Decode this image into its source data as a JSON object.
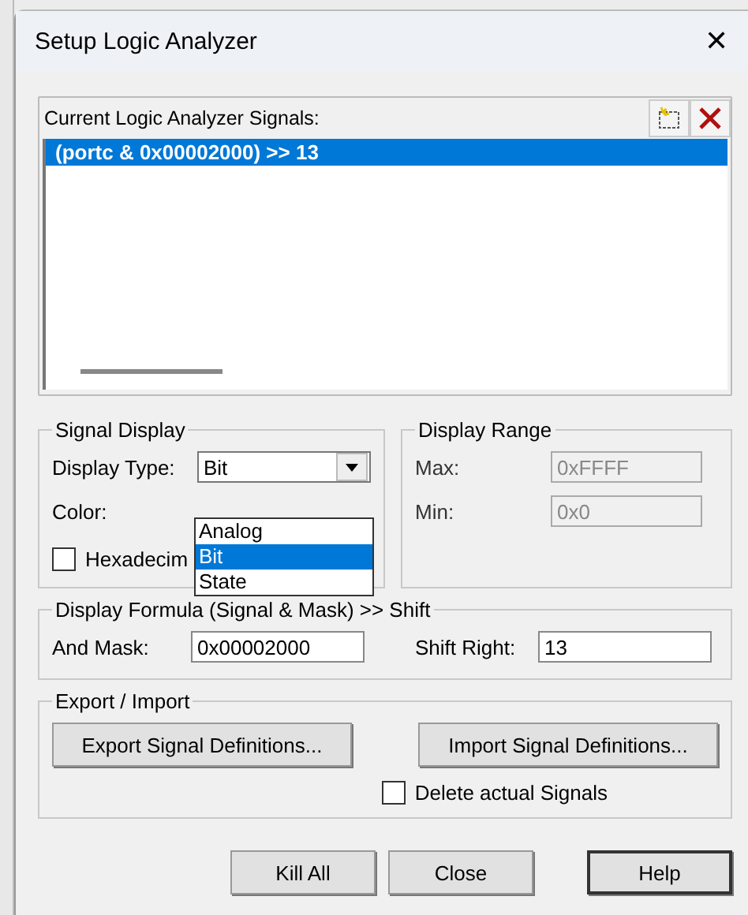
{
  "window": {
    "title": "Setup Logic Analyzer",
    "close": "✕"
  },
  "signals": {
    "label": "Current Logic Analyzer Signals:",
    "items": [
      {
        "text": "(portc & 0x00002000) >> 13",
        "selected": true
      }
    ]
  },
  "signal_display": {
    "title": "Signal Display",
    "type_label": "Display Type:",
    "type_value": "Bit",
    "color_label": "Color:",
    "hex": {
      "label": "Hexadecim",
      "checked": false
    },
    "dropdown": [
      {
        "text": "Analog",
        "selected": false
      },
      {
        "text": "Bit",
        "selected": true
      },
      {
        "text": "State",
        "selected": false
      }
    ]
  },
  "display_range": {
    "title": "Display Range",
    "max_label": "Max:",
    "max_value": "0xFFFF",
    "min_label": "Min:",
    "min_value": "0x0",
    "disabled": true
  },
  "formula": {
    "title": "Display Formula (Signal & Mask) >> Shift",
    "mask_label": "And Mask:",
    "mask_value": "0x00002000",
    "shift_label": "Shift Right:",
    "shift_value": "13"
  },
  "export_import": {
    "title": "Export / Import",
    "export_button": "Export Signal Definitions...",
    "import_button": "Import Signal Definitions...",
    "delete": {
      "label": "Delete actual Signals",
      "checked": false
    }
  },
  "buttons": [
    {
      "label": "Kill All",
      "default": false
    },
    {
      "label": "Close",
      "default": false
    },
    {
      "label": "Help",
      "default": true
    }
  ]
}
